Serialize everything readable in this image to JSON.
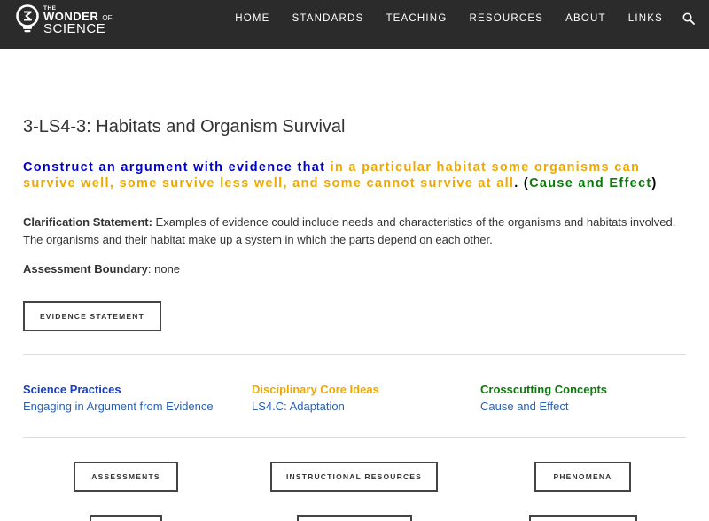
{
  "logo": {
    "the": "THE",
    "wonder": "WONDER",
    "of": "OF",
    "science": "SCIENCE"
  },
  "nav": {
    "items": [
      "HOME",
      "STANDARDS",
      "TEACHING",
      "RESOURCES",
      "ABOUT",
      "LINKS"
    ],
    "search_icon": "search-icon"
  },
  "page": {
    "title": "3-LS4-3: Habitats and Organism Survival",
    "pe": {
      "part1": "Construct an argument with evidence that",
      "part2": "in a particular habitat some organisms can survive well, some survive less well, and some cannot survive at all",
      "period": ".",
      "paren_open": "(",
      "part3": "Cause and Effect",
      "paren_close": ")"
    },
    "clarification_label": "Clarification Statement:",
    "clarification_text": "Examples of evidence could include needs and characteristics of the organisms and habitats involved. The organisms and their habitat make up a system in which the parts depend on each other.",
    "assessment_label": "Assessment Boundary",
    "assessment_text": ": none",
    "evidence_button": "EVIDENCE STATEMENT"
  },
  "dimensions": {
    "sp": {
      "heading": "Science Practices",
      "link": "Engaging in Argument from Evidence"
    },
    "dci": {
      "heading": "Disciplinary Core Ideas",
      "link": "LS4.C: Adaptation"
    },
    "cc": {
      "heading": "Crosscutting Concepts",
      "link": "Cause and Effect"
    }
  },
  "buttons": {
    "assessments": "ASSESSMENTS",
    "instructional": "INSTRUCTIONAL RESOURCES",
    "phenomena": "PHENOMENA"
  },
  "colors": {
    "header_bg": "#2b2b2b",
    "pe_blue": "#0000cc",
    "pe_orange": "#f0a800",
    "pe_green": "#0a7a0a",
    "link_blue": "#2b5fb2"
  }
}
